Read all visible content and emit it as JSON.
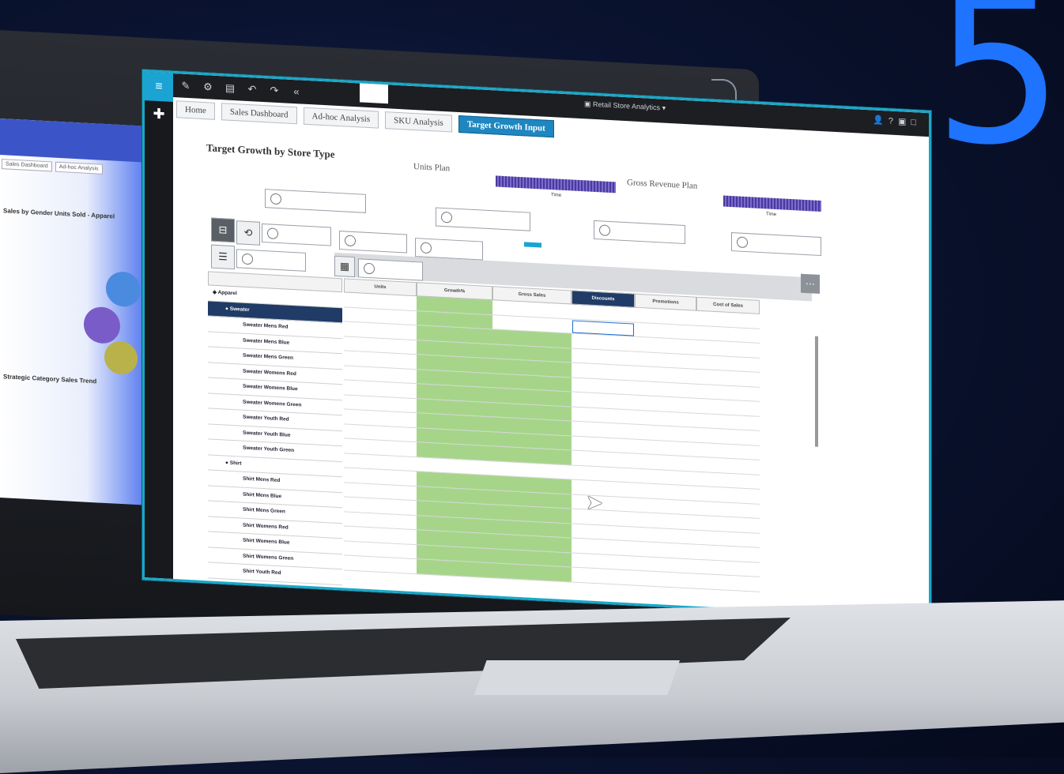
{
  "promo": {
    "number": "5"
  },
  "back_window": {
    "tabs": [
      "Sales Dashboard",
      "Ad-hoc Analysis"
    ],
    "chart1_title": "Sales by Gender Units Sold - Apparel",
    "chart2_title": "Strategic Category Sales Trend"
  },
  "toolbar": {
    "cube_title": "Retail Store Analytics",
    "icons": [
      "pencil-icon",
      "settings-icon",
      "save-icon",
      "undo-icon",
      "redo-icon",
      "back-icon"
    ]
  },
  "tabs": [
    {
      "label": "Home",
      "active": false
    },
    {
      "label": "Sales Dashboard",
      "active": false
    },
    {
      "label": "Ad-hoc Analysis",
      "active": false
    },
    {
      "label": "SKU Analysis",
      "active": false
    },
    {
      "label": "Target Growth Input",
      "active": true
    }
  ],
  "page": {
    "title": "Target Growth by Store Type",
    "units_plan_label": "Units Plan",
    "gross_revenue_plan_label": "Gross Revenue Plan",
    "spark_axis_label": "Time"
  },
  "colors": {
    "accent": "#1aa3d3",
    "active_tab": "#1e86c0",
    "selected_row": "#1f3b66",
    "input_cell": "#a6d58a",
    "promo_number": "#1e73ff"
  },
  "table": {
    "columns": [
      "Units",
      "Growth%",
      "Gross Sales",
      "Discounts",
      "Promotions",
      "Cost of Sales"
    ],
    "rows": [
      {
        "label": "Apparel",
        "level": 0,
        "selected": false
      },
      {
        "label": "Sweater",
        "level": 1,
        "selected": true
      },
      {
        "label": "Sweater Mens Red",
        "level": 2,
        "selected": false
      },
      {
        "label": "Sweater Mens Blue",
        "level": 2,
        "selected": false
      },
      {
        "label": "Sweater Mens Green",
        "level": 2,
        "selected": false
      },
      {
        "label": "Sweater Womens Red",
        "level": 2,
        "selected": false
      },
      {
        "label": "Sweater Womens Blue",
        "level": 2,
        "selected": false
      },
      {
        "label": "Sweater Womens Green",
        "level": 2,
        "selected": false
      },
      {
        "label": "Sweater Youth Red",
        "level": 2,
        "selected": false
      },
      {
        "label": "Sweater Youth Blue",
        "level": 2,
        "selected": false
      },
      {
        "label": "Sweater Youth Green",
        "level": 2,
        "selected": false
      },
      {
        "label": "Shirt",
        "level": 1,
        "selected": false
      },
      {
        "label": "Shirt Mens Red",
        "level": 2,
        "selected": false
      },
      {
        "label": "Shirt Mens Blue",
        "level": 2,
        "selected": false
      },
      {
        "label": "Shirt Mens Green",
        "level": 2,
        "selected": false
      },
      {
        "label": "Shirt Womens Red",
        "level": 2,
        "selected": false
      },
      {
        "label": "Shirt Womens Blue",
        "level": 2,
        "selected": false
      },
      {
        "label": "Shirt Womens Green",
        "level": 2,
        "selected": false
      },
      {
        "label": "Shirt Youth Red",
        "level": 2,
        "selected": false
      }
    ]
  }
}
